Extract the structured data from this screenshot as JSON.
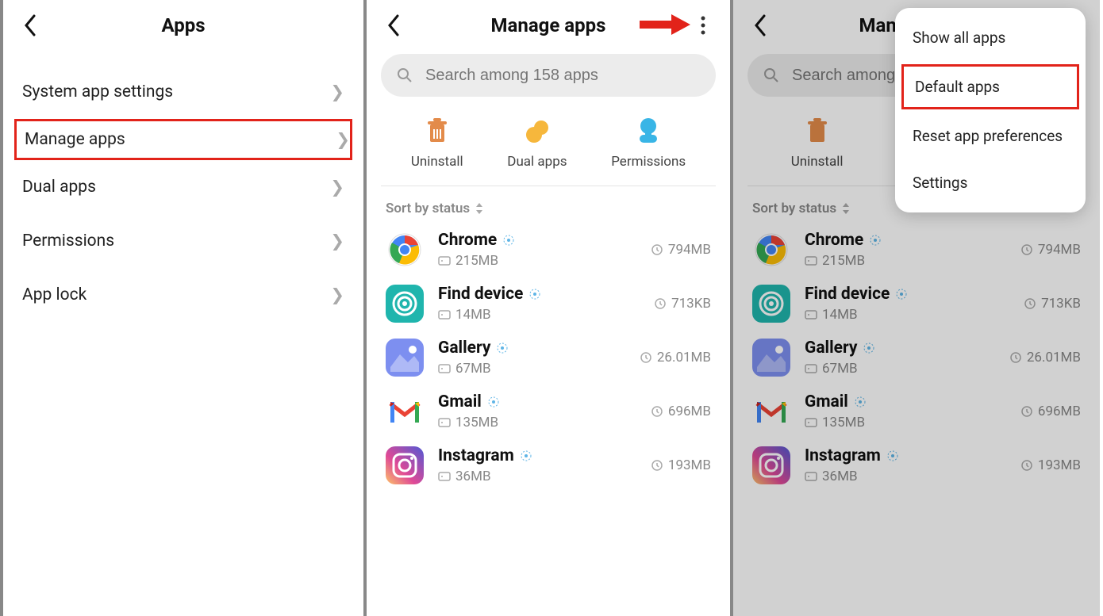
{
  "panel1": {
    "title": "Apps",
    "items": [
      {
        "label": "System app settings"
      },
      {
        "label": "Manage apps"
      },
      {
        "label": "Dual apps"
      },
      {
        "label": "Permissions"
      },
      {
        "label": "App lock"
      }
    ]
  },
  "panel2": {
    "title": "Manage apps",
    "search_placeholder": "Search among 158 apps",
    "actions": {
      "uninstall": "Uninstall",
      "dual": "Dual apps",
      "permissions": "Permissions"
    },
    "sort_label": "Sort by status",
    "apps": [
      {
        "name": "Chrome",
        "storage": "215MB",
        "data": "794MB"
      },
      {
        "name": "Find device",
        "storage": "14MB",
        "data": "713KB"
      },
      {
        "name": "Gallery",
        "storage": "67MB",
        "data": "26.01MB"
      },
      {
        "name": "Gmail",
        "storage": "135MB",
        "data": "696MB"
      },
      {
        "name": "Instagram",
        "storage": "36MB",
        "data": "193MB"
      }
    ]
  },
  "panel3": {
    "title": "Manage apps",
    "search_placeholder": "Search among",
    "actions": {
      "uninstall": "Uninstall",
      "dual_initial": "D"
    },
    "sort_label": "Sort by status",
    "apps": [
      {
        "name": "Chrome",
        "storage": "215MB",
        "data": "794MB"
      },
      {
        "name": "Find device",
        "storage": "14MB",
        "data": "713KB"
      },
      {
        "name": "Gallery",
        "storage": "67MB",
        "data": "26.01MB"
      },
      {
        "name": "Gmail",
        "storage": "135MB",
        "data": "696MB"
      },
      {
        "name": "Instagram",
        "storage": "36MB",
        "data": "193MB"
      }
    ],
    "menu": [
      "Show all apps",
      "Default apps",
      "Reset app preferences",
      "Settings"
    ]
  },
  "colors": {
    "highlight": "#e2231a",
    "trash": "#e38b4a",
    "dual": "#f6b73c",
    "perm": "#39b5e6"
  }
}
